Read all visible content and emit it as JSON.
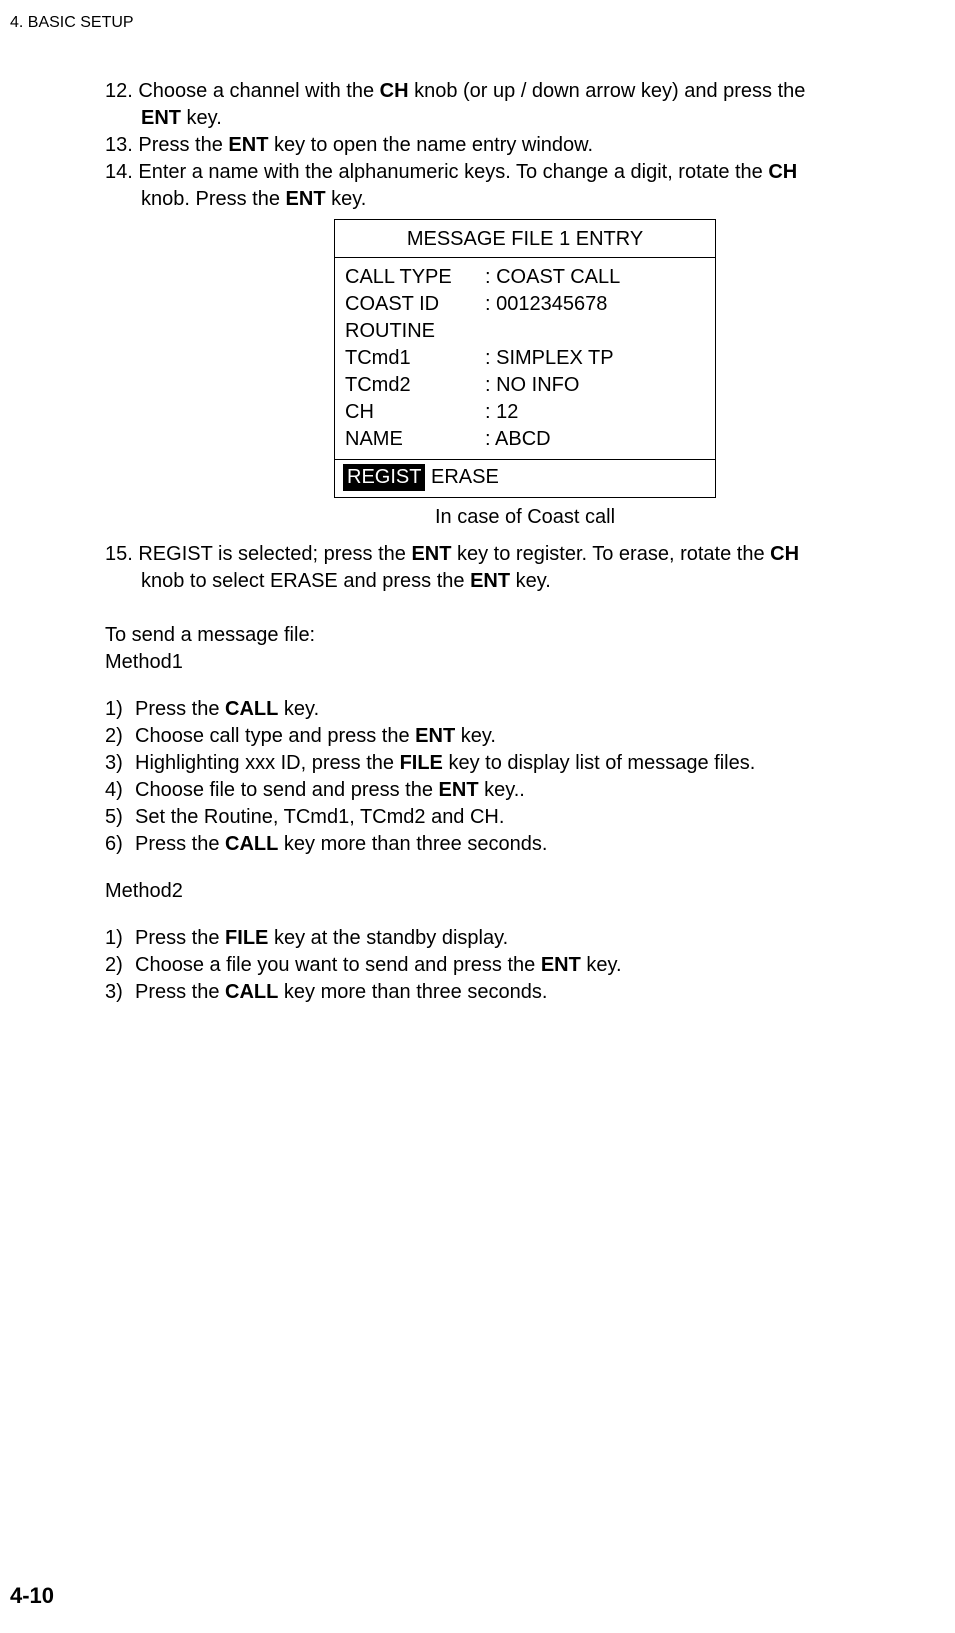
{
  "header": {
    "running": "4. BASIC SETUP"
  },
  "steps": {
    "s12": {
      "pre": "12. Choose a channel with the ",
      "b1": "CH",
      "mid": " knob (or up / down arrow key) and press the ",
      "b2": "ENT",
      "post": " key."
    },
    "s13": {
      "pre": "13. Press the ",
      "b1": "ENT",
      "post": " key to open the name entry window."
    },
    "s14": {
      "pre": "14. Enter a name with the alphanumeric keys. To change a digit, rotate the ",
      "b1": "CH",
      "line2pre": "knob. Press the ",
      "b2": "ENT",
      "line2post": " key."
    },
    "s15": {
      "pre": "15. REGIST is selected; press the ",
      "b1": "ENT",
      "mid": " key to register. To erase, rotate the ",
      "b2": "CH",
      "line2pre": "knob to select ERASE and press the ",
      "b3": "ENT",
      "line2post": " key."
    }
  },
  "msgbox": {
    "title": "MESSAGE FILE 1 ENTRY",
    "rows": [
      {
        "label": "CALL TYPE",
        "value": ": COAST CALL"
      },
      {
        "label": "COAST ID",
        "value": ": 0012345678"
      },
      {
        "label": "ROUTINE",
        "value": ""
      },
      {
        "label": "TCmd1",
        "value": ": SIMPLEX TP"
      },
      {
        "label": " TCmd2",
        "value": ": NO INFO"
      },
      {
        "label": " CH",
        "value": ": 12"
      },
      {
        "label": " NAME",
        "value": ": ABCD"
      }
    ],
    "footer": {
      "regist": "REGIST",
      "erase": " ERASE"
    },
    "caption": "In case of Coast call"
  },
  "send": {
    "intro": "To send a message file:",
    "method1_label": "Method1",
    "method1": [
      {
        "num": "1)",
        "pre": "Press the ",
        "b1": "CALL",
        "post": " key."
      },
      {
        "num": "2)",
        "pre": "Choose call type and press the ",
        "b1": "ENT",
        "post": " key."
      },
      {
        "num": "3)",
        "pre": "Highlighting xxx ID, press the ",
        "b1": "FILE",
        "post": " key to display list of message files."
      },
      {
        "num": "4)",
        "pre": "Choose file to send and press the ",
        "b1": "ENT",
        "post": " key.."
      },
      {
        "num": "5)",
        "pre": "Set the Routine, TCmd1, TCmd2 and CH.",
        "b1": "",
        "post": ""
      },
      {
        "num": "6)",
        "pre": "Press the ",
        "b1": "CALL",
        "post": " key more than three seconds."
      }
    ],
    "method2_label": "Method2",
    "method2": [
      {
        "num": "1)",
        "pre": "Press the ",
        "b1": "FILE",
        "post": " key at the standby display."
      },
      {
        "num": "2)",
        "pre": "Choose a file you want to send and press the ",
        "b1": "ENT",
        "post": " key."
      },
      {
        "num": "3)",
        "pre": "Press the ",
        "b1": "CALL",
        "post": " key more than three seconds."
      }
    ]
  },
  "page_number": "4-10"
}
